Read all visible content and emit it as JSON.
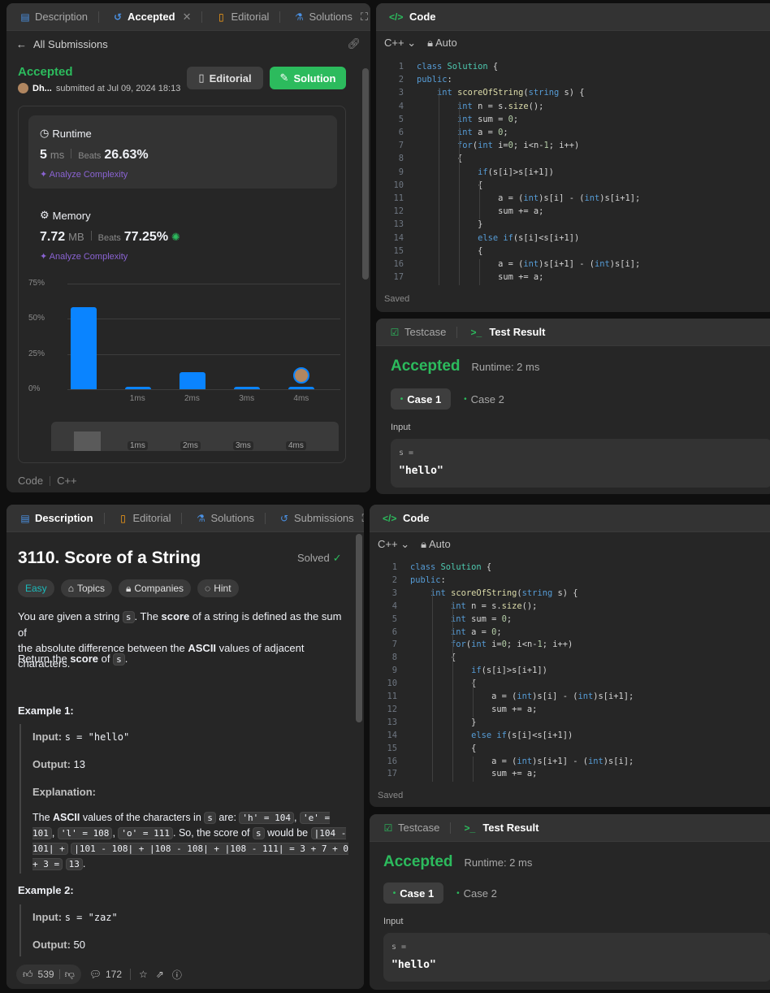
{
  "top_left": {
    "tabs": [
      {
        "label": "Description",
        "icon": "description-icon"
      },
      {
        "label": "Accepted",
        "icon": "history-icon"
      },
      {
        "label": "Editorial",
        "icon": "book-icon"
      },
      {
        "label": "Solutions",
        "icon": "flask-icon"
      }
    ],
    "back_label": "All Submissions",
    "status": "Accepted",
    "user": "Dh...",
    "submitted_text": "submitted at Jul 09, 2024 18:13",
    "editorial_btn": "Editorial",
    "solution_btn": "Solution",
    "runtime": {
      "title": "Runtime",
      "value": "5",
      "unit": "ms",
      "beats_label": "Beats",
      "beats": "26.63%",
      "analyze": "Analyze Complexity"
    },
    "memory": {
      "title": "Memory",
      "value": "7.72",
      "unit": "MB",
      "beats_label": "Beats",
      "beats": "77.25%",
      "analyze": "Analyze Complexity"
    },
    "footer_code": "Code",
    "footer_lang": "C++"
  },
  "chart_data": {
    "type": "bar",
    "categories": [
      "",
      "1ms",
      "2ms",
      "3ms",
      "4ms"
    ],
    "values": [
      58,
      2,
      12,
      2,
      2
    ],
    "y_ticks": [
      "75%",
      "50%",
      "25%",
      "0%"
    ],
    "ylim": [
      0,
      75
    ],
    "grid": true,
    "highlight_category": "4ms",
    "bar_color": "#0a84ff",
    "mini_labels": [
      "1ms",
      "2ms",
      "3ms",
      "4ms"
    ]
  },
  "code_panel": {
    "title": "Code",
    "lang": "C++",
    "mode": "Auto",
    "saved": "Saved",
    "lines": [
      "class Solution {",
      "public:",
      "    int scoreOfString(string s) {",
      "        int n = s.size();",
      "        int sum = 0;",
      "        int a = 0;",
      "        for(int i=0; i<n-1; i++)",
      "        {",
      "            if(s[i]>s[i+1])",
      "            {",
      "                a = (int)s[i] - (int)s[i+1];",
      "                sum += a;",
      "            }",
      "            else if(s[i]<s[i+1])",
      "            {",
      "                a = (int)s[i+1] - (int)s[i];",
      "                sum += a;"
    ]
  },
  "result_panel": {
    "tab_testcase": "Testcase",
    "tab_result": "Test Result",
    "status": "Accepted",
    "runtime": "Runtime: 2 ms",
    "case1": "Case 1",
    "case2": "Case 2",
    "input_label": "Input",
    "var": "s =",
    "value": "\"hello\""
  },
  "description": {
    "tabs": [
      {
        "label": "Description"
      },
      {
        "label": "Editorial"
      },
      {
        "label": "Solutions"
      },
      {
        "label": "Submissions"
      }
    ],
    "title": "3110. Score of a String",
    "solved": "Solved",
    "chips": [
      "Easy",
      "Topics",
      "Companies",
      "Hint"
    ],
    "p1_a": "You are given a string",
    "p1_s": "s",
    "p1_b": ". The",
    "p1_score": "score",
    "p1_c": "of a string is defined as the sum of",
    "p1_d": "the absolute difference between the",
    "p1_ascii": "ASCII",
    "p1_e": "values of adjacent characters.",
    "p2_a": "Return the",
    "p2_score": "score",
    "p2_b": "of",
    "p2_s": "s",
    "p2_c": ".",
    "ex1_title": "Example 1:",
    "ex1_input_label": "Input:",
    "ex1_input": "s = \"hello\"",
    "ex1_output_label": "Output:",
    "ex1_output": "13",
    "ex1_expl_label": "Explanation:",
    "ex1_e1": "The",
    "ex1_ascii": "ASCII",
    "ex1_e2": "values of the characters in",
    "ex1_s1": "s",
    "ex1_e3": "are:",
    "ex1_h": "'h' = 104",
    "ex1_e": "'e' = 101",
    "ex1_l": "'l' = 108",
    "ex1_o": "'o' = 111",
    "ex1_e4": ". So, the score of",
    "ex1_s2": "s",
    "ex1_e5": "would be",
    "ex1_calc1": "|104 - 101| +",
    "ex1_calc2": "|101 - 108| + |108 - 108| + |108 - 111| = 3 + 7 + 0 + 3 =",
    "ex1_calc3": "13",
    "ex1_dot": ".",
    "ex2_title": "Example 2:",
    "ex2_input_label": "Input:",
    "ex2_input": "s = \"zaz\"",
    "ex2_output_label": "Output:",
    "ex2_output": "50",
    "likes": "539",
    "comments": "172"
  }
}
